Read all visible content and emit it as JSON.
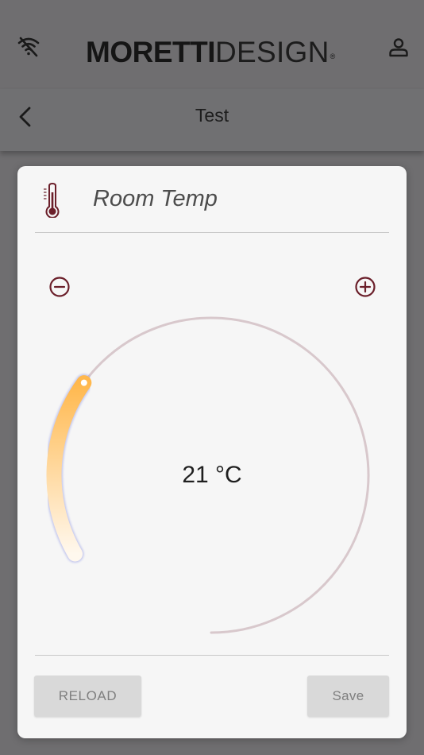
{
  "header": {
    "brand_bold": "MORETTI",
    "brand_light": "DESIGN",
    "brand_mark": "®",
    "wifi_icon": "wifi-off-icon",
    "account_icon": "person-icon"
  },
  "nav": {
    "title": "Test",
    "back_icon": "chevron-left-icon"
  },
  "card": {
    "title": "Room Temp",
    "icon": "thermometer-icon",
    "temperature": "21 °C",
    "dial_fill_fraction": 0.22,
    "minus_icon": "minus-circle-icon",
    "plus_icon": "plus-circle-icon",
    "reload_label": "RELOAD",
    "save_label": "Save"
  },
  "colors": {
    "background_overlay": "#6f6e70",
    "card": "#f6f6f6",
    "accent_dark_red": "#6b1f2a",
    "dial_track": "#d8c8cc",
    "dial_fill_start": "#fff8ee",
    "dial_fill_end": "#ffb84d"
  }
}
